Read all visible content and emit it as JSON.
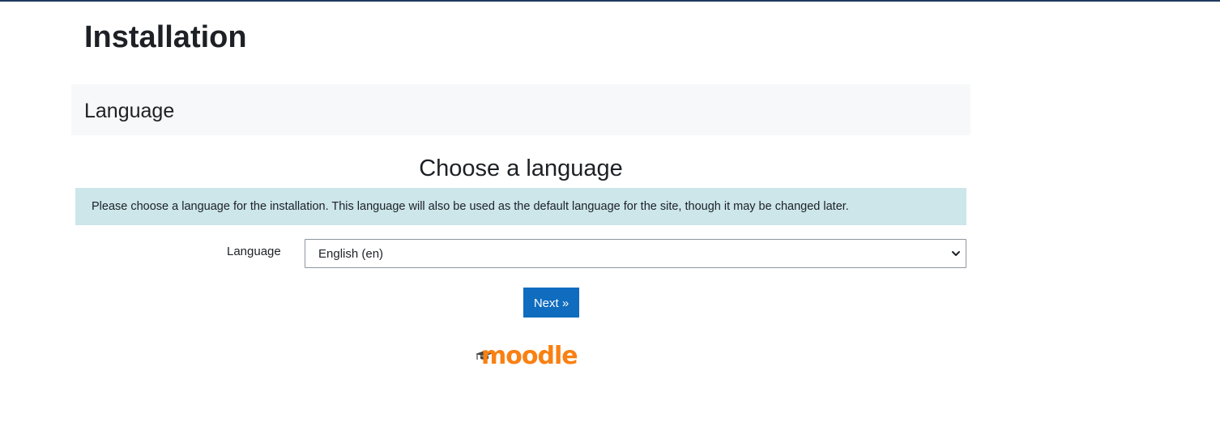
{
  "page": {
    "title": "Installation"
  },
  "section": {
    "title": "Language"
  },
  "main": {
    "heading": "Choose a language",
    "info_text": "Please choose a language for the installation. This language will also be used as the default language for the site, though it may be changed later."
  },
  "form": {
    "language_label": "Language",
    "language_selected": "English (en)",
    "next_button": "Next »"
  },
  "logo": {
    "text": "moodle",
    "color": "#f98012"
  },
  "colors": {
    "top_rule": "#1f3a5f",
    "button": "#0f6cbf",
    "info_background": "#cce6ea",
    "section_background": "#f7f8f9"
  },
  "icons": {
    "select": "chevron-down-icon",
    "logo": "mortarboard-icon"
  }
}
